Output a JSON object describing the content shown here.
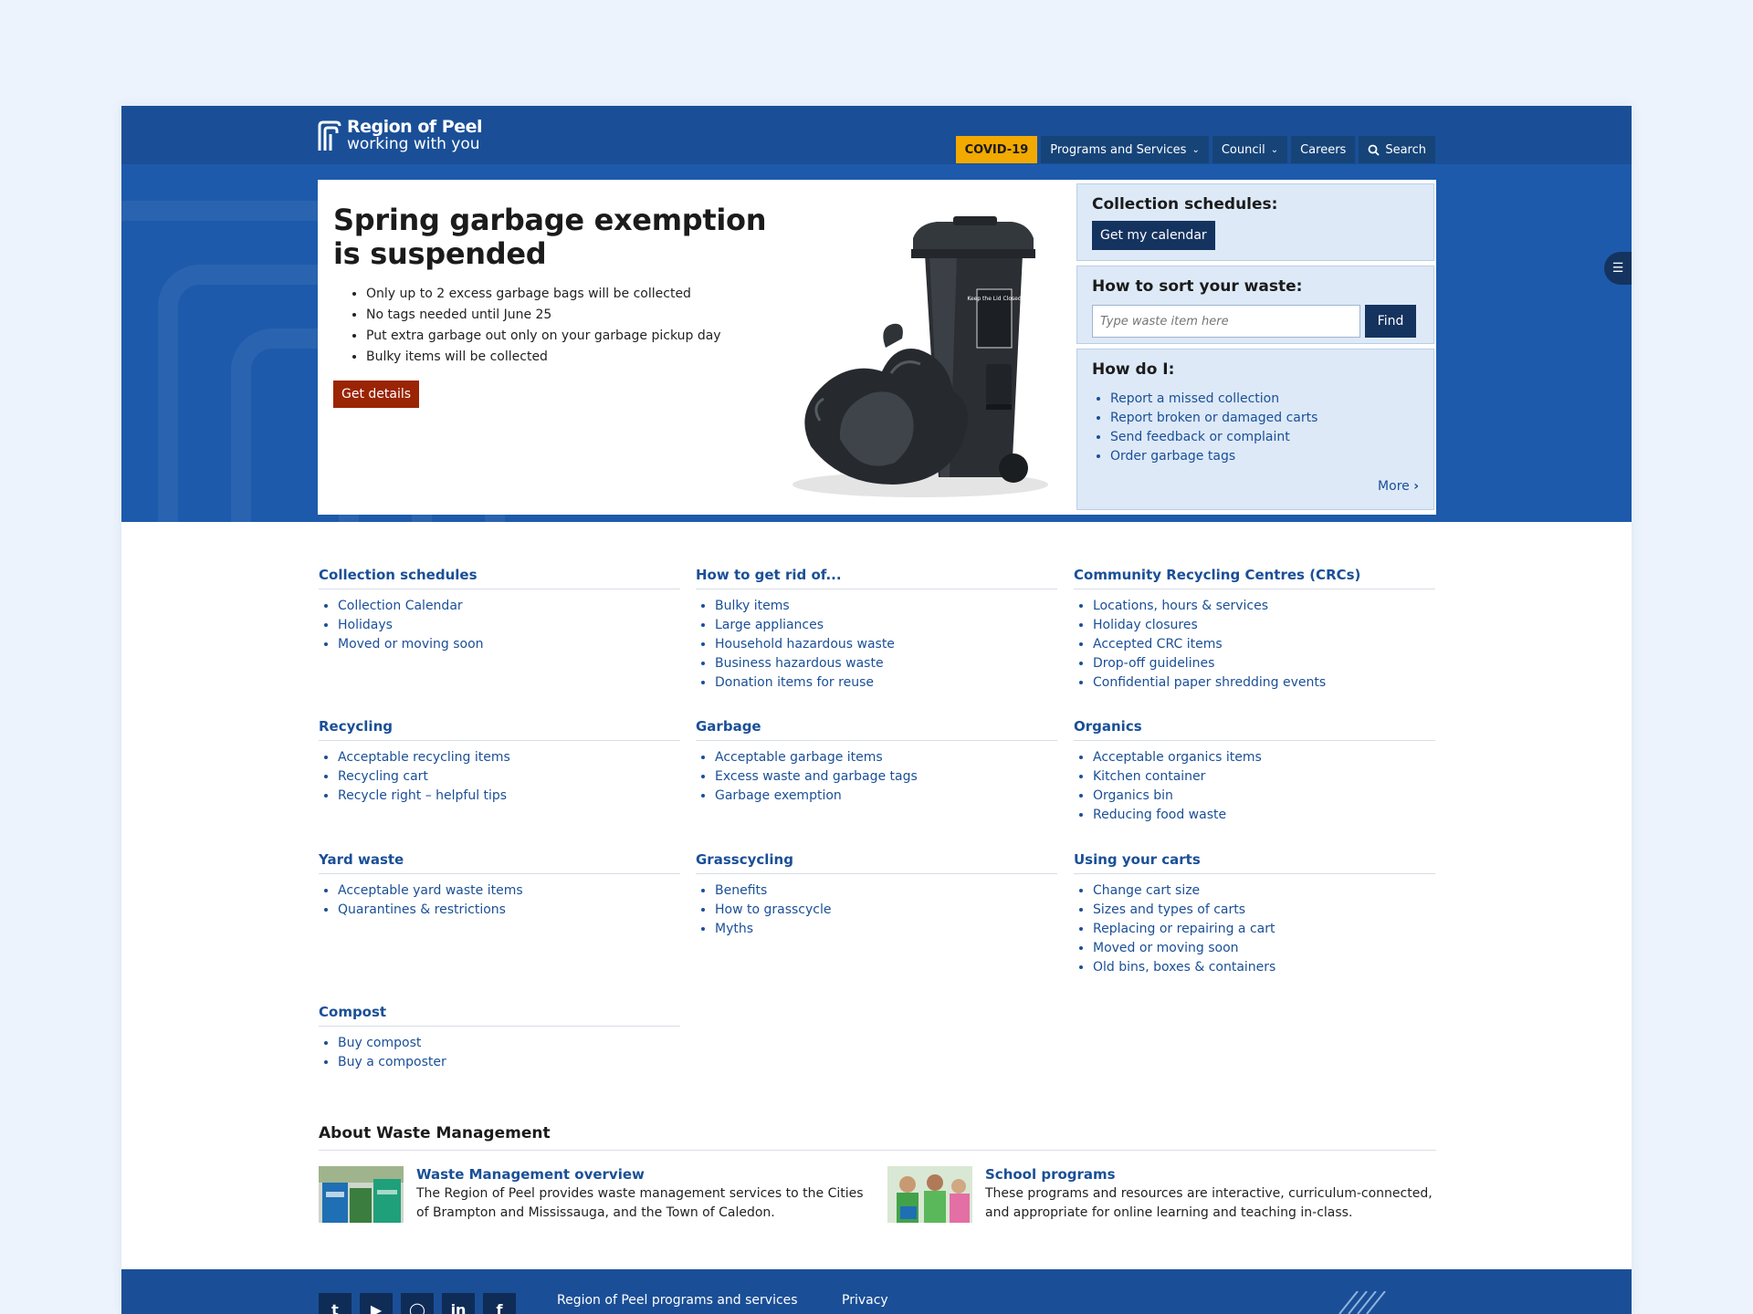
{
  "header": {
    "logo_line1": "Region of Peel",
    "logo_line2": "working with you",
    "nav": {
      "covid": "COVID-19",
      "programs": "Programs and Services",
      "council": "Council",
      "careers": "Careers",
      "search": "Search"
    }
  },
  "hero": {
    "title": "Spring garbage exemption is suspended",
    "bullets": [
      "Only up to 2 excess garbage bags will be collected",
      "No tags needed until June 25",
      "Put extra garbage out only on your garbage pickup day",
      "Bulky items will be collected"
    ],
    "button": "Get details",
    "bin_label": "Keep the Lid Closed"
  },
  "sidebar": {
    "collection_title": "Collection schedules:",
    "calendar_button": "Get my calendar",
    "sort_title": "How to sort your waste:",
    "sort_placeholder": "Type waste item here",
    "find_button": "Find",
    "how_title": "How do I:",
    "how_items": [
      "Report a missed collection",
      "Report broken or damaged carts",
      "Send feedback or complaint",
      "Order garbage tags"
    ],
    "more": "More"
  },
  "groups": [
    {
      "title": "Collection schedules",
      "items": [
        "Collection Calendar",
        "Holidays",
        "Moved or moving soon"
      ]
    },
    {
      "title": "How to get rid of...",
      "items": [
        "Bulky items",
        "Large appliances",
        "Household hazardous waste",
        "Business hazardous waste",
        "Donation items for reuse"
      ]
    },
    {
      "title": "Community Recycling Centres (CRCs)",
      "items": [
        "Locations, hours & services",
        "Holiday closures",
        "Accepted CRC items",
        "Drop-off guidelines",
        "Confidential paper shredding events"
      ]
    },
    {
      "title": "Recycling",
      "items": [
        "Acceptable recycling items",
        "Recycling cart",
        "Recycle right – helpful tips"
      ]
    },
    {
      "title": "Garbage",
      "items": [
        "Acceptable garbage items",
        "Excess waste and garbage tags",
        "Garbage exemption"
      ]
    },
    {
      "title": "Organics",
      "items": [
        "Acceptable organics items",
        "Kitchen container",
        "Organics bin",
        "Reducing food waste"
      ]
    },
    {
      "title": "Yard waste",
      "items": [
        "Acceptable yard waste items",
        "Quarantines & restrictions"
      ]
    },
    {
      "title": "Grasscycling",
      "items": [
        "Benefits",
        "How to grasscycle",
        "Myths"
      ]
    },
    {
      "title": "Using your carts",
      "items": [
        "Change cart size",
        "Sizes and types of carts",
        "Replacing or repairing a cart",
        "Moved or moving soon",
        "Old bins, boxes & containers"
      ]
    },
    {
      "title": "Compost",
      "items": [
        "Buy compost",
        "Buy a composter"
      ]
    }
  ],
  "about": {
    "title": "About Waste Management",
    "cards": [
      {
        "title": "Waste Management overview",
        "desc": "The Region of Peel provides waste management services to the Cities of Brampton and Mississauga, and the Town of Caledon."
      },
      {
        "title": "School programs",
        "desc": "These programs and resources are interactive, curriculum-connected, and appropriate for online learning and teaching in-class."
      }
    ]
  },
  "footer": {
    "link1": "Region of Peel programs and services",
    "link2": "Privacy",
    "social_icons": [
      "twitter-icon",
      "youtube-icon",
      "instagram-icon",
      "linkedin-icon",
      "facebook-icon"
    ]
  },
  "colors": {
    "brand_blue": "#1a4f97",
    "band_blue": "#1d5aab",
    "covid_yellow": "#f2a900",
    "cta_red": "#9a2404",
    "dark_navy": "#15335f",
    "panel_bg": "#dde9f7"
  }
}
